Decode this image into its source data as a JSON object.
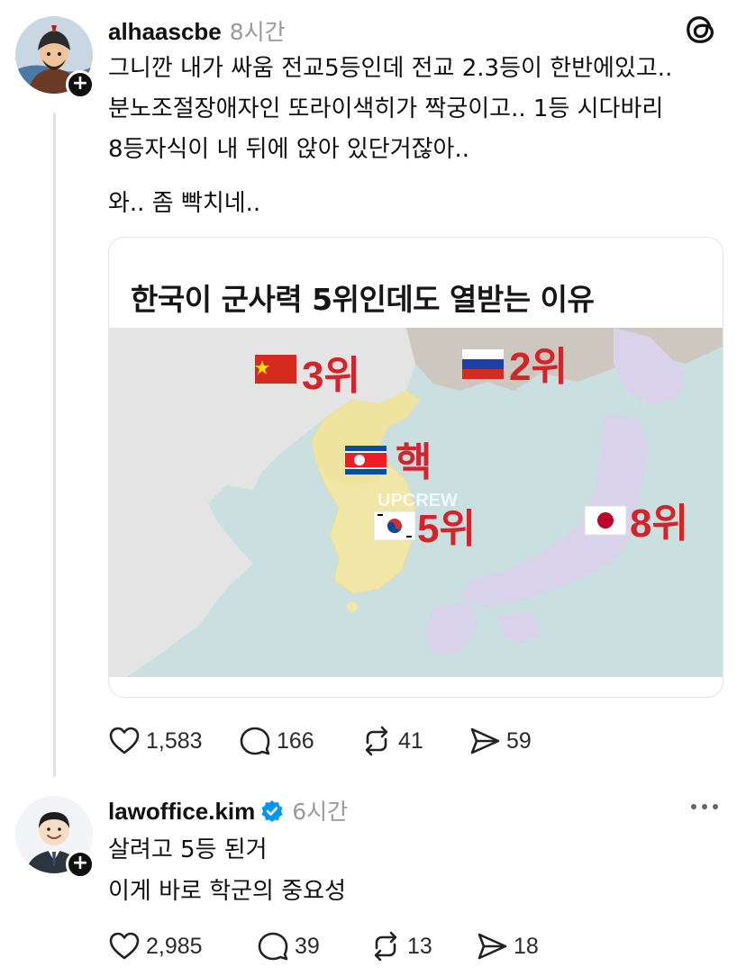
{
  "post1": {
    "username": "alhaascbe",
    "time": "8시간",
    "lines": [
      "그니깐 내가 싸움 전교5등인데 전교 2.3등이 한반에있고..",
      "분노조절장애자인 또라이색히가 짝궁이고.. 1등 시다바리",
      "8등자식이 내 뒤에 앉아 있단거잖아..",
      "와.. 좀 빡치네.."
    ],
    "embed": {
      "title": "한국이 군사력 5위인데도 열받는 이유",
      "labels": {
        "china": "3위",
        "russia": "2위",
        "north_korea": "핵",
        "south_korea": "5위",
        "japan": "8위",
        "watermark": "UPCREW"
      }
    },
    "stats": {
      "likes": "1,583",
      "comments": "166",
      "reposts": "41",
      "shares": "59"
    }
  },
  "post2": {
    "username": "lawoffice.kim",
    "time": "6시간",
    "lines": [
      "살려고 5등 된거",
      "이게 바로 학군의 중요성"
    ],
    "stats": {
      "likes": "2,985",
      "comments": "39",
      "reposts": "13",
      "shares": "18"
    }
  },
  "icons": {
    "follow": "plus-icon",
    "logo": "threads-logo-icon",
    "verified": "verified-badge-icon",
    "like": "heart-icon",
    "comment": "comment-bubble-icon",
    "repost": "repost-icon",
    "share": "send-icon",
    "more": "more-icon"
  },
  "colors": {
    "accent_red": "#d2252a",
    "verified_blue": "#0095f6",
    "muted": "#9a9a9a"
  }
}
